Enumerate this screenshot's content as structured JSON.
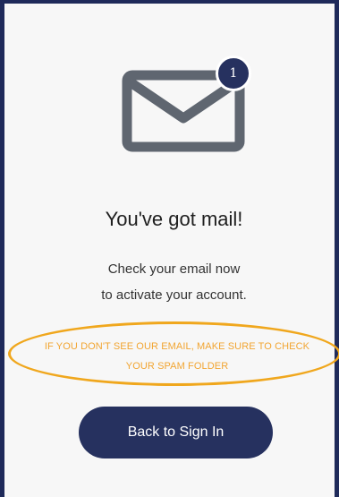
{
  "icons": {
    "mail": "envelope-icon",
    "badge": "notification-badge"
  },
  "badge_count": "1",
  "heading": "You've got mail!",
  "message_line1": "Check your email now",
  "message_line2": "to activate your account.",
  "spam_note_line1": "IF YOU DON'T SEE OUR EMAIL, MAKE SURE TO CHECK",
  "spam_note_line2": "YOUR SPAM FOLDER",
  "back_button_label": "Back to Sign In",
  "colors": {
    "primary": "#26315f",
    "icon_gray": "#5f6670",
    "highlight": "#f0a71d",
    "spam_text": "#f2a531",
    "border": "#1f2a5a"
  }
}
